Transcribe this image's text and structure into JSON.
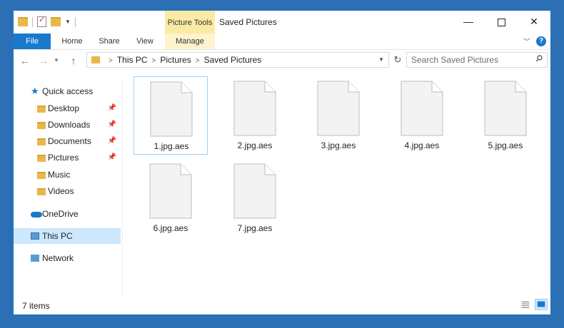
{
  "window": {
    "title": "Saved Pictures",
    "context_group": "Picture Tools",
    "min_glyph": "—",
    "close_glyph": "✕"
  },
  "ribbon": {
    "tabs": [
      "File",
      "Home",
      "Share",
      "View",
      "Manage"
    ]
  },
  "address": {
    "crumbs": [
      "This PC",
      "Pictures",
      "Saved Pictures"
    ]
  },
  "search": {
    "placeholder": "Search Saved Pictures"
  },
  "nav": {
    "quick_access": "Quick access",
    "items": [
      "Desktop",
      "Downloads",
      "Documents",
      "Pictures",
      "Music",
      "Videos"
    ],
    "onedrive": "OneDrive",
    "this_pc": "This PC",
    "network": "Network"
  },
  "files": [
    "1.jpg.aes",
    "2.jpg.aes",
    "3.jpg.aes",
    "4.jpg.aes",
    "5.jpg.aes",
    "6.jpg.aes",
    "7.jpg.aes"
  ],
  "status": {
    "count": "7 items"
  },
  "colors": {
    "accent": "#1979ca",
    "context_tab": "#fbeaa3",
    "selection": "#cce8ff"
  }
}
